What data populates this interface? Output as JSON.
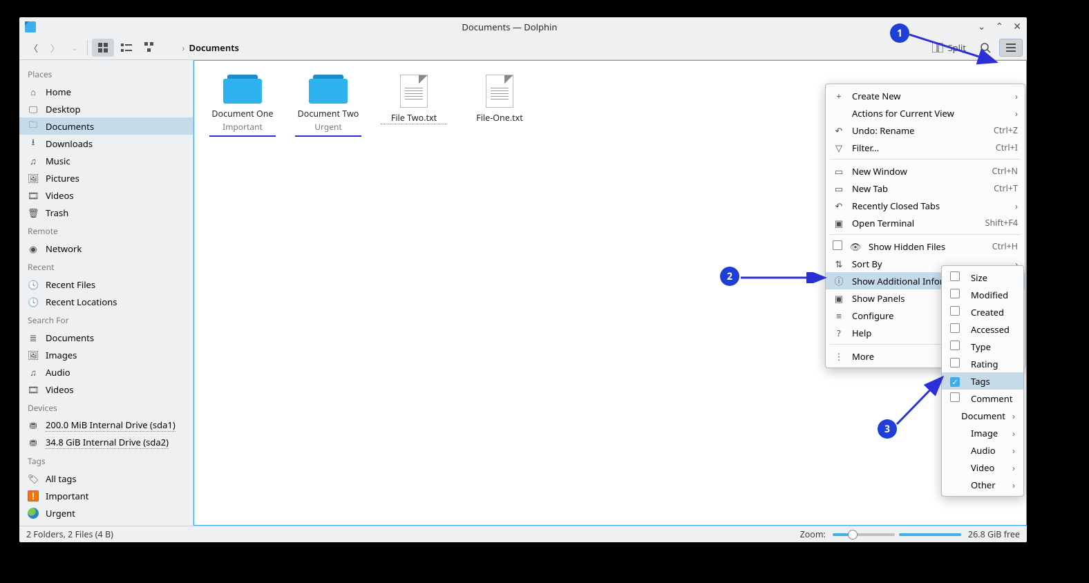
{
  "window_title": "Documents — Dolphin",
  "toolbar": {
    "split_label": "Split",
    "breadcrumb": "Documents"
  },
  "sidebar": {
    "sections": [
      {
        "header": "Places",
        "items": [
          {
            "icon": "home",
            "label": "Home"
          },
          {
            "icon": "desktop",
            "label": "Desktop"
          },
          {
            "icon": "folder",
            "label": "Documents",
            "selected": true
          },
          {
            "icon": "download",
            "label": "Downloads"
          },
          {
            "icon": "music",
            "label": "Music"
          },
          {
            "icon": "image",
            "label": "Pictures"
          },
          {
            "icon": "video",
            "label": "Videos"
          },
          {
            "icon": "trash",
            "label": "Trash"
          }
        ]
      },
      {
        "header": "Remote",
        "items": [
          {
            "icon": "network",
            "label": "Network"
          }
        ]
      },
      {
        "header": "Recent",
        "items": [
          {
            "icon": "recent",
            "label": "Recent Files"
          },
          {
            "icon": "recent-loc",
            "label": "Recent Locations"
          }
        ]
      },
      {
        "header": "Search For",
        "items": [
          {
            "icon": "doc",
            "label": "Documents"
          },
          {
            "icon": "image",
            "label": "Images"
          },
          {
            "icon": "music",
            "label": "Audio"
          },
          {
            "icon": "video",
            "label": "Videos"
          }
        ]
      },
      {
        "header": "Devices",
        "items": [
          {
            "icon": "drive",
            "label": "200.0 MiB Internal Drive (sda1)",
            "dotted": true
          },
          {
            "icon": "drive",
            "label": "34.8 GiB Internal Drive (sda2)",
            "dotted": true
          }
        ]
      },
      {
        "header": "Tags",
        "items": [
          {
            "icon": "tag",
            "label": "All tags"
          },
          {
            "icon": "tag-orange",
            "label": "Important"
          },
          {
            "icon": "tag-globe",
            "label": "Urgent"
          }
        ]
      }
    ]
  },
  "files": [
    {
      "type": "folder",
      "name": "Document One",
      "tag": "Important"
    },
    {
      "type": "folder",
      "name": "Document Two",
      "tag": "Urgent"
    },
    {
      "type": "file",
      "name": "File Two.txt",
      "selected": true
    },
    {
      "type": "file",
      "name": "File-One.txt"
    }
  ],
  "status": {
    "left": "2 Folders, 2 Files (4 B)",
    "zoom_label": "Zoom:",
    "free": "26.8 GiB free"
  },
  "menu_main": [
    {
      "icon": "+",
      "label": "Create New",
      "arrow": true
    },
    {
      "label": "Actions for Current View",
      "arrow": true
    },
    {
      "icon": "↶",
      "label": "Undo: Rename",
      "shortcut": "Ctrl+Z"
    },
    {
      "icon": "▽",
      "label": "Filter...",
      "shortcut": "Ctrl+I"
    },
    {
      "sep": true
    },
    {
      "icon": "▭",
      "label": "New Window",
      "shortcut": "Ctrl+N"
    },
    {
      "icon": "▭",
      "label": "New Tab",
      "shortcut": "Ctrl+T"
    },
    {
      "icon": "↶",
      "label": "Recently Closed Tabs",
      "arrow": true
    },
    {
      "icon": "▣",
      "label": "Open Terminal",
      "shortcut": "Shift+F4"
    },
    {
      "sep": true
    },
    {
      "check": false,
      "icon": "👁",
      "label": "Show Hidden Files",
      "shortcut": "Ctrl+H"
    },
    {
      "icon": "⇅",
      "label": "Sort By",
      "arrow": true
    },
    {
      "icon": "ⓘ",
      "label": "Show Additional Information",
      "arrow": true,
      "hover": true
    },
    {
      "icon": "▣",
      "label": "Show Panels",
      "arrow": true
    },
    {
      "icon": "≡",
      "label": "Configure",
      "arrow": true
    },
    {
      "icon": "?",
      "label": "Help",
      "arrow": true
    },
    {
      "sep": true
    },
    {
      "icon": "⋮",
      "label": "More"
    }
  ],
  "menu_sub": [
    {
      "check": false,
      "label": "Size"
    },
    {
      "check": false,
      "label": "Modified"
    },
    {
      "check": false,
      "label": "Created"
    },
    {
      "check": false,
      "label": "Accessed"
    },
    {
      "check": false,
      "label": "Type"
    },
    {
      "check": false,
      "label": "Rating"
    },
    {
      "check": true,
      "label": "Tags",
      "hover": true
    },
    {
      "check": false,
      "label": "Comment"
    },
    {
      "label": "Document",
      "arrow": true
    },
    {
      "label": "Image",
      "arrow": true
    },
    {
      "label": "Audio",
      "arrow": true
    },
    {
      "label": "Video",
      "arrow": true
    },
    {
      "label": "Other",
      "arrow": true
    }
  ],
  "annotations": {
    "a1": "1",
    "a2": "2",
    "a3": "3"
  }
}
